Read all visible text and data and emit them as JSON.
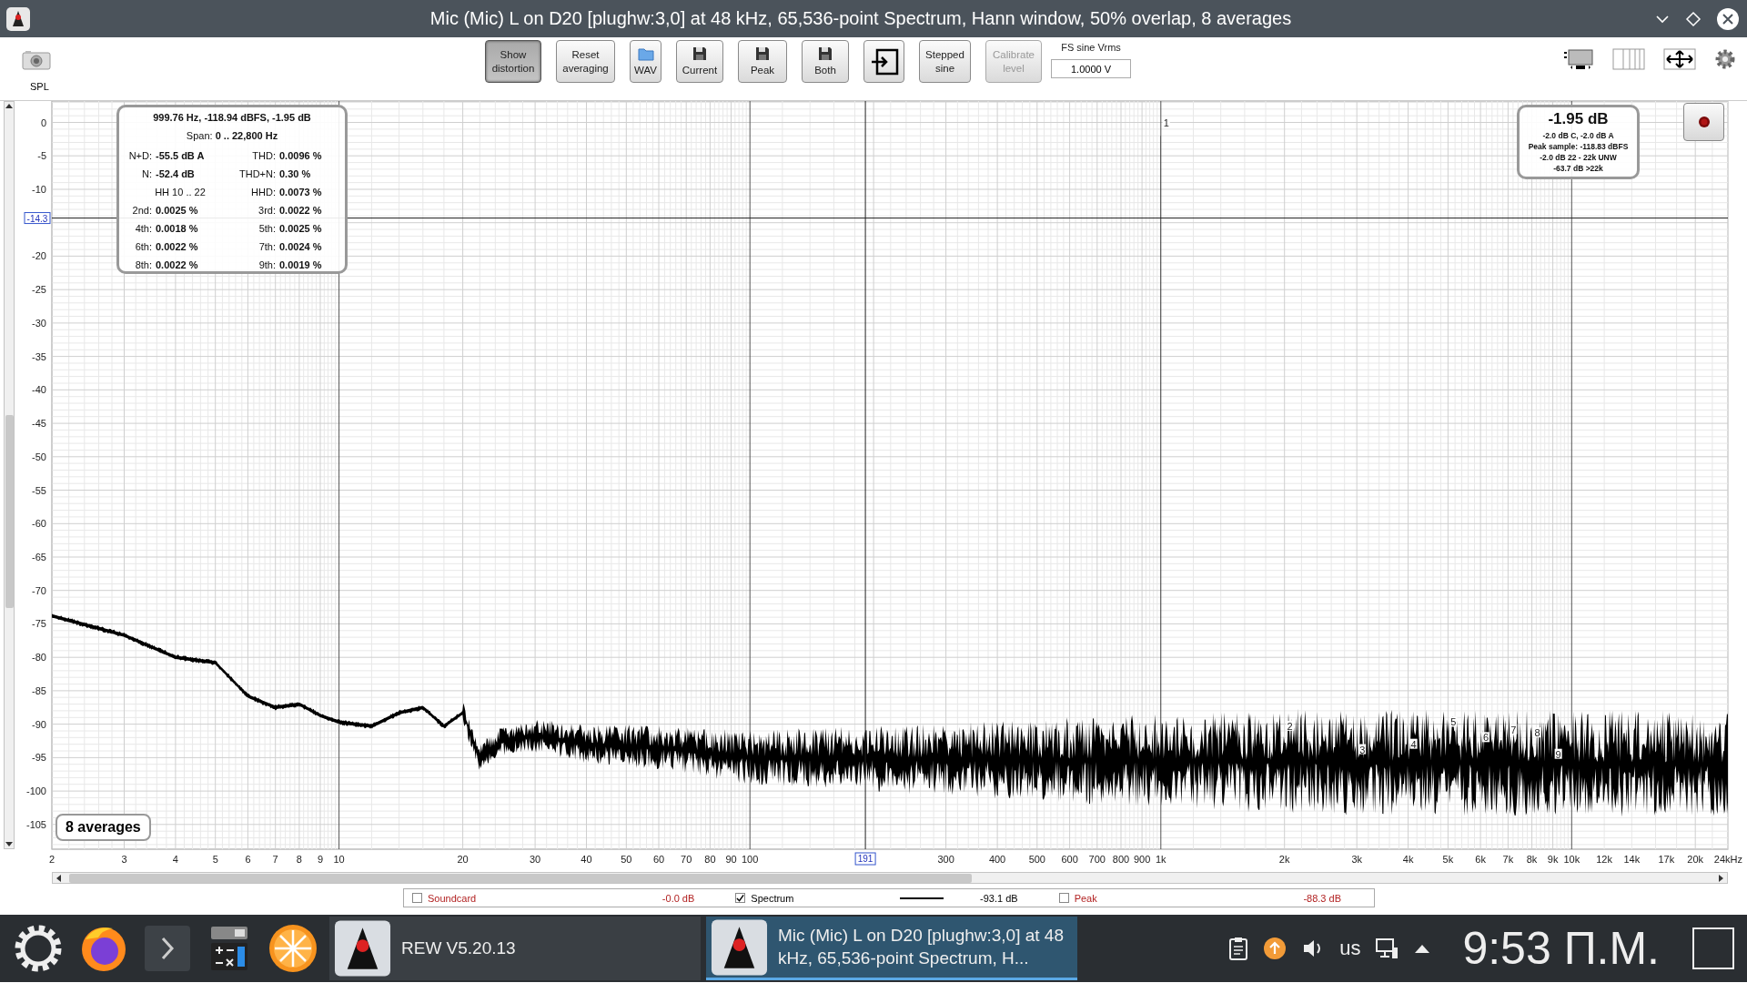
{
  "window": {
    "title": "Mic (Mic) L on D20 [plughw:3,0] at 48 kHz, 65,536-point Spectrum, Hann window, 50% overlap, 8 averages"
  },
  "toolbar": {
    "buttons": [
      {
        "kind": "text",
        "label": "Show distortion",
        "selected": true,
        "disabled": false
      },
      {
        "kind": "text",
        "label": "Reset averaging",
        "selected": false,
        "disabled": false
      },
      {
        "kind": "folder",
        "label": "WAV",
        "selected": false,
        "disabled": false
      },
      {
        "kind": "save",
        "label": "Current",
        "selected": false,
        "disabled": false
      },
      {
        "kind": "save",
        "label": "Peak",
        "selected": false,
        "disabled": false
      },
      {
        "kind": "save",
        "label": "Both",
        "selected": false,
        "disabled": false
      },
      {
        "kind": "import",
        "selected": false,
        "disabled": false
      },
      {
        "kind": "text",
        "label": "Stepped sine",
        "selected": false,
        "disabled": false
      },
      {
        "kind": "text",
        "label": "Calibrate level",
        "selected": false,
        "disabled": true
      }
    ],
    "fs_sine": {
      "label": "FS sine Vrms",
      "value": "1.0000 V"
    }
  },
  "axis_title": "SPL",
  "chart": {
    "y_labels": [
      "0",
      "-5",
      "-10",
      "-20",
      "-25",
      "-30",
      "-35",
      "-40",
      "-45",
      "-50",
      "-55",
      "-60",
      "-65",
      "-70",
      "-75",
      "-80",
      "-85",
      "-90",
      "-95",
      "-100",
      "-105"
    ],
    "x_labels": [
      "2",
      "3",
      "4",
      "5",
      "6",
      "7",
      "8",
      "9",
      "10",
      "20",
      "30",
      "40",
      "50",
      "60",
      "70",
      "80",
      "90",
      "100",
      "300",
      "400",
      "500",
      "600",
      "700",
      "800",
      "900",
      "1k",
      "2k",
      "3k",
      "4k",
      "5k",
      "6k",
      "7k",
      "8k",
      "9k",
      "10k",
      "12k",
      "14k",
      "17k",
      "20k",
      "24kHz"
    ],
    "cursor": {
      "level": "-14.3",
      "frequency": "191"
    },
    "harmonic_markers": [
      "1",
      "2",
      "3",
      "4",
      "5",
      "6",
      "7",
      "8",
      "9"
    ]
  },
  "info_box": {
    "header": "999.76 Hz, -118.94 dBFS, -1.95 dB",
    "span": "Span: **0 .. 22,800 Hz**",
    "rows": [
      [
        {
          "label": "N+D:",
          "value": "-55.5 dB A"
        },
        {
          "label": "THD:",
          "value": "0.0096 %"
        }
      ],
      [
        {
          "label": "N:",
          "value": "-52.4 dB"
        },
        {
          "label": "THD+N:",
          "value": "0.30 %"
        }
      ],
      [
        {
          "label": "HH 10 .. 22"
        },
        {
          "label": "HHD:",
          "value": "0.0073 %"
        }
      ],
      [
        {
          "label": "2nd:",
          "value": "0.0025 %"
        },
        {
          "label": "3rd:",
          "value": "0.0022 %"
        }
      ],
      [
        {
          "label": "4th:",
          "value": "0.0018 %"
        },
        {
          "label": "5th:",
          "value": "0.0025 %"
        }
      ],
      [
        {
          "label": "6th:",
          "value": "0.0022 %"
        },
        {
          "label": "7th:",
          "value": "0.0024 %"
        }
      ],
      [
        {
          "label": "8th:",
          "value": "0.0022 %"
        },
        {
          "label": "9th:",
          "value": "0.0019 %"
        }
      ]
    ]
  },
  "level_box": {
    "reading": "-1.95 dB",
    "lines": [
      "-2.0 dB C, -2.0 dB A",
      "Peak sample: -118.83 dBFS",
      "-2.0 dB 22 - 22k UNW",
      "-63.7 dB >22k"
    ]
  },
  "averages_badge": "8 averages",
  "legend": [
    {
      "name": "Soundcard",
      "checked": false,
      "reading": "-0.0 dB",
      "color": "#b22222"
    },
    {
      "name": "Spectrum",
      "checked": true,
      "reading": "-93.1 dB",
      "color": "#000000"
    },
    {
      "name": "Peak",
      "checked": false,
      "reading": "-88.3 dB",
      "color": "#b22222"
    }
  ],
  "taskbar": {
    "tasks": [
      {
        "label": "REW V5.20.13",
        "selected": false
      },
      {
        "label": "Mic (Mic) L on D20 [plughw:3,0] at 48 kHz, 65,536-point Spectrum, H...",
        "selected": true
      }
    ],
    "keyboard_layout": "us",
    "clock": "9:53 П.М."
  }
}
